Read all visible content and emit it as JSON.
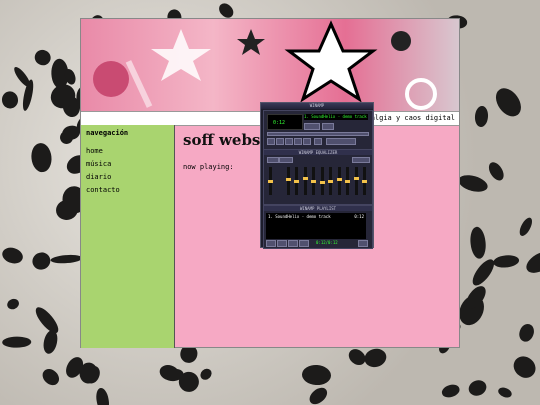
{
  "background": {
    "pattern": "leopard-print",
    "base_color": "#cfcac2",
    "spot_color": "#1c1b1a"
  },
  "site": {
    "marquee_text": "nostalgia y caos digital",
    "sidebar": {
      "heading": "navegación",
      "links": [
        "home",
        "música",
        "diario",
        "contacto"
      ],
      "bg_color": "#a9d46f"
    },
    "main": {
      "title": "soff website",
      "now_playing": "now playing:",
      "bg_color": "#f6a9c4"
    }
  },
  "winamp": {
    "title": "WINAMP",
    "time": "0:12",
    "song": "1. SoundHelix - demo track",
    "equalizer_title": "WINAMP EQUALIZER",
    "eq_on_label": "ON",
    "eq_auto_label": "AUTO",
    "eq_presets_label": "PRESETS",
    "eq_bands": [
      "PREAMP",
      "70",
      "180",
      "320",
      "600",
      "1K",
      "3K",
      "6K",
      "12K",
      "14K",
      "16K"
    ],
    "eq_levels": [
      0.5,
      0.55,
      0.5,
      0.6,
      0.5,
      0.45,
      0.5,
      0.55,
      0.5,
      0.6,
      0.5
    ],
    "playlist_title": "WINAMP PLAYLIST",
    "playlist": [
      {
        "name": "1. SoundHelix - demo track",
        "duration": "0:12"
      }
    ],
    "playlist_time": "0:12/0:12"
  }
}
